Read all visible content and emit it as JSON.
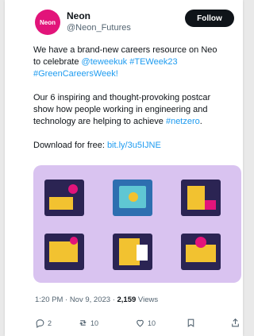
{
  "author": {
    "name": "Neon",
    "handle": "@Neon_Futures",
    "avatar_text": "Neon"
  },
  "follow_label": "Follow",
  "tweet": {
    "line1": "We have a brand-new careers resource on Neo",
    "line2_prefix": "to celebrate ",
    "mention": "@teweekuk",
    "hashtag1": "#TEWeek23",
    "hashtag2": "#GreenCareersWeek!",
    "p2_line1": "Our 6 inspiring and thought-provoking postcar",
    "p2_line2": "show how people working in engineering and",
    "p2_line3_prefix": "technology are helping to achieve ",
    "hashtag3": "#netzero",
    "p2_line3_suffix": ".",
    "download_prefix": "Download for free: ",
    "download_link": "bit.ly/3u5IJNE"
  },
  "meta": {
    "time": "1:20 PM · Nov 9, 2023 · ",
    "views_count": "2,159",
    "views_label": " Views"
  },
  "actions": {
    "replies": "2",
    "retweets": "10",
    "likes": "10"
  },
  "colors": {
    "link": "#1d9bf0",
    "media_bg": "#d9c3f0",
    "brand": "#e2147a"
  }
}
